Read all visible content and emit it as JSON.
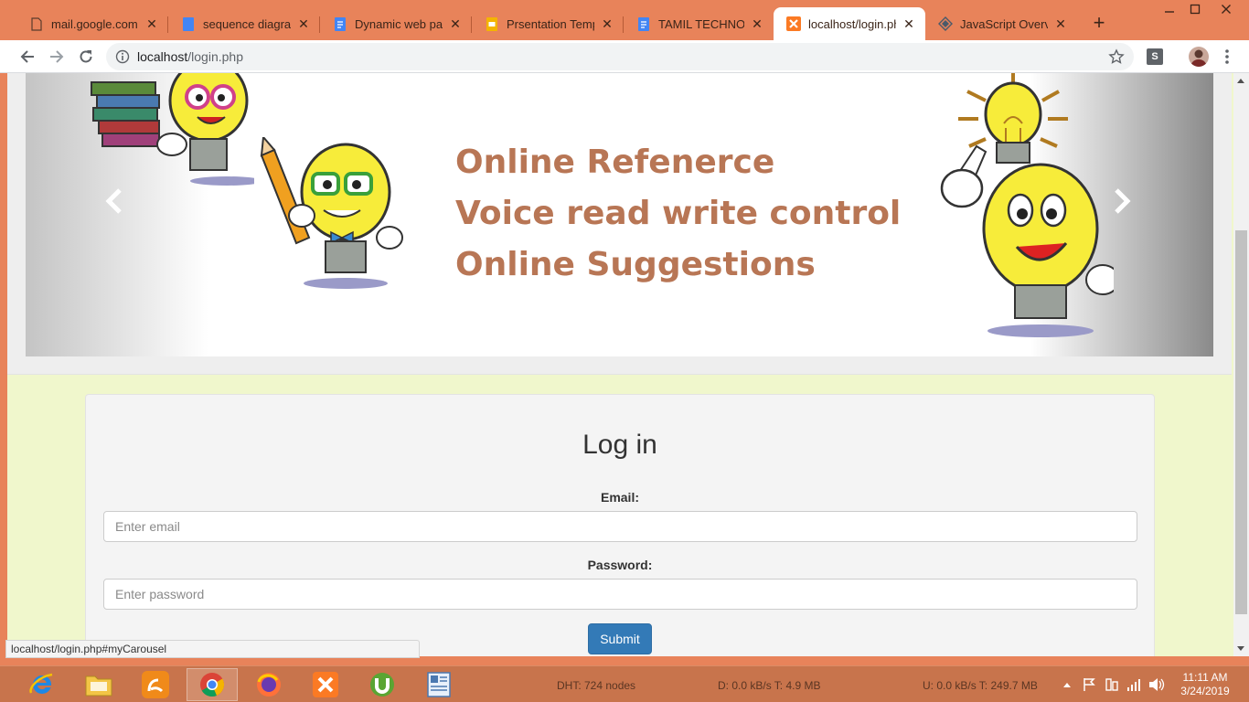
{
  "browser": {
    "tabs": [
      {
        "title": "mail.google.com",
        "icon": "page-icon"
      },
      {
        "title": "sequence diagram",
        "icon": "doc-icon"
      },
      {
        "title": "Dynamic web page",
        "icon": "doc-icon"
      },
      {
        "title": "Prsentation Template",
        "icon": "slides-icon"
      },
      {
        "title": "TAMIL TECHNO-LE",
        "icon": "doc-icon"
      },
      {
        "title": "localhost/login.php",
        "icon": "xampp-icon"
      },
      {
        "title": "JavaScript Overview",
        "icon": "js-icon"
      }
    ],
    "active_tab_index": 5,
    "close_glyph": "✕",
    "new_tab_glyph": "+",
    "address": {
      "host": "localhost",
      "path": "/login.php"
    },
    "extension_label": "S"
  },
  "carousel": {
    "lines": [
      "Online Refenerce",
      "Voice read write control",
      "Online Suggestions"
    ],
    "text_color": "#b87655"
  },
  "login": {
    "title": "Log in",
    "email_label": "Email:",
    "email_placeholder": "Enter email",
    "password_label": "Password:",
    "password_placeholder": "Enter password",
    "submit_label": "Submit",
    "button_color": "#337ab7"
  },
  "status_url": "localhost/login.php#myCarousel",
  "taskbar": {
    "apps": [
      "internet-explorer-icon",
      "file-explorer-icon",
      "uc-browser-icon",
      "chrome-icon",
      "firefox-icon",
      "xampp-icon",
      "utorrent-icon",
      "wordpad-icon"
    ],
    "dht": "DHT: 724 nodes",
    "download": "D: 0.0 kB/s T: 4.9 MB",
    "upload": "U: 0.0 kB/s T: 249.7 MB",
    "time": "11:11 AM",
    "date": "3/24/2019"
  },
  "theme": {
    "accent": "#e8835a",
    "page_bg": "#f0f7cc"
  }
}
